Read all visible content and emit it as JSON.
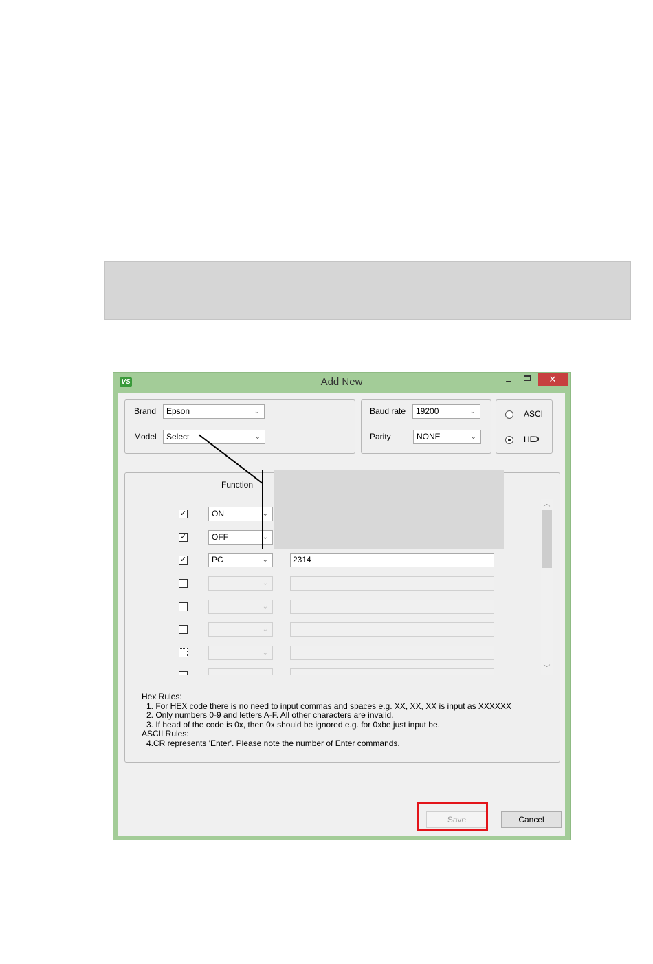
{
  "window": {
    "title": "Add New",
    "logo": "VS",
    "controls": {
      "minimize": "–",
      "maximize_icon": "maximize-icon",
      "close": "✕"
    }
  },
  "device": {
    "brand_label": "Brand",
    "brand_value": "Epson",
    "model_label": "Model",
    "model_value": "Select"
  },
  "serial": {
    "baud_label": "Baud rate",
    "baud_value": "19200",
    "parity_label": "Parity",
    "parity_value": "NONE"
  },
  "encoding": {
    "ascii_label": "ASCI",
    "hex_label": "HEX",
    "selected": "HEX"
  },
  "functions": {
    "header": "Function",
    "rows": [
      {
        "checked": true,
        "function": "ON",
        "code": "",
        "enabled": true
      },
      {
        "checked": true,
        "function": "OFF",
        "code": "",
        "enabled": true
      },
      {
        "checked": true,
        "function": "PC",
        "code": "2314",
        "enabled": true
      },
      {
        "checked": false,
        "function": "",
        "code": "",
        "enabled": false
      },
      {
        "checked": false,
        "function": "",
        "code": "",
        "enabled": false
      },
      {
        "checked": false,
        "function": "",
        "code": "",
        "enabled": false
      },
      {
        "checked": false,
        "function": "",
        "code": "",
        "enabled": false
      },
      {
        "checked": false,
        "function": "",
        "code": "",
        "enabled": false
      }
    ]
  },
  "rules": {
    "hex_title": "Hex Rules:",
    "hex_1": "1. For HEX code there is no need to input commas and spaces e.g. XX, XX, XX  is input as XXXXXX",
    "hex_2": "2. Only numbers 0-9 and letters A-F. All other characters are invalid.",
    "hex_3": "3. If head of the code is 0x, then 0x should be ignored e.g. for 0xbe just input be.",
    "ascii_title": "ASCII Rules:",
    "ascii_4": "4.CR represents 'Enter'. Please note the number of Enter commands."
  },
  "buttons": {
    "save": "Save",
    "cancel": "Cancel"
  },
  "colors": {
    "window_frame": "#a3cc98",
    "close_button": "#c7403f",
    "highlight": "#e3141a"
  }
}
